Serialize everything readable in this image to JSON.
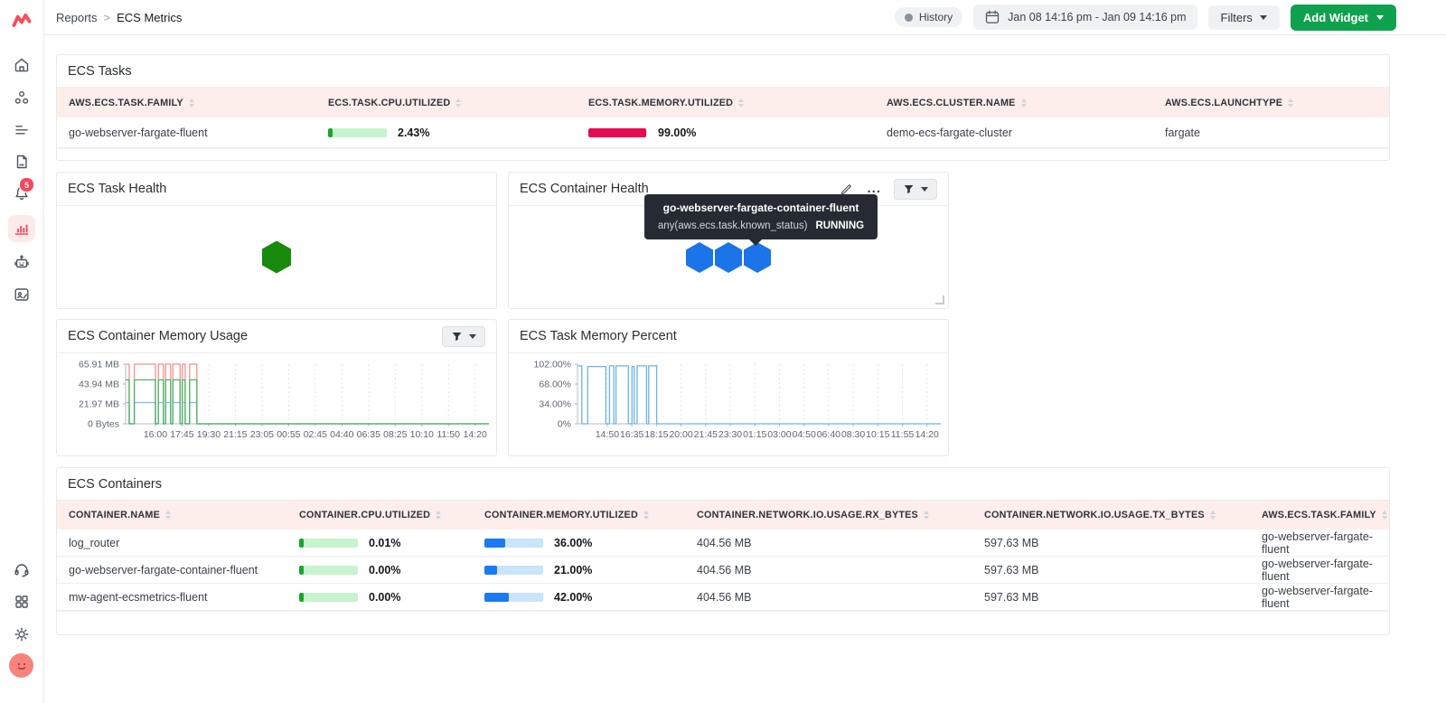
{
  "topbar": {
    "breadcrumb": {
      "section": "Reports",
      "separator": ">",
      "page": "ECS Metrics"
    },
    "history_label": "History",
    "date_range": "Jan 08 14:16 pm - Jan 09 14:16 pm",
    "filters_label": "Filters",
    "add_widget_label": "Add Widget"
  },
  "sidebar": {
    "notification_count": "5"
  },
  "colors": {
    "brand_red": "#fa4b57",
    "add_widget_green": "#0fa24e",
    "task_health_hex": "#178a0c",
    "container_health_hex": "#1b74e8",
    "table_header_pink": "#fdeeec",
    "cpu_bar_green": "#1ca52b",
    "memory_bar_red": "#e60a4e",
    "memory_bar_blue": "#1b79f1"
  },
  "ecs_tasks": {
    "title": "ECS Tasks",
    "columns": [
      "AWS.ECS.TASK.FAMILY",
      "ECS.TASK.CPU.UTILIZED",
      "ECS.TASK.MEMORY.UTILIZED",
      "AWS.ECS.CLUSTER.NAME",
      "AWS.ECS.LAUNCHTYPE"
    ],
    "rows": [
      {
        "family": "go-webserver-fargate-fluent",
        "cpu_label": "2.43%",
        "cpu_pct": 2.43,
        "memory_label": "99.00%",
        "memory_pct": 99,
        "cluster": "demo-ecs-fargate-cluster",
        "launchtype": "fargate"
      }
    ]
  },
  "task_health": {
    "title": "ECS Task Health"
  },
  "container_health": {
    "title": "ECS Container Health",
    "more_label": "...",
    "tooltip": {
      "title": "go-webserver-fargate-container-fluent",
      "metric": "any(aws.ecs.task.known_status)",
      "value": "RUNNING"
    }
  },
  "chart_data": [
    {
      "type": "line",
      "title": "ECS Container Memory Usage",
      "xlabel": "",
      "ylabel": "",
      "ylim": [
        0,
        65.91
      ],
      "grid": "vertical-dashed",
      "legend": "none",
      "yticks": [
        {
          "value": 65.91,
          "label": "65.91 MB"
        },
        {
          "value": 43.94,
          "label": "43.94 MB"
        },
        {
          "value": 21.97,
          "label": "21.97 MB"
        },
        {
          "value": 0,
          "label": "0 Bytes"
        }
      ],
      "xticks": [
        "16:00",
        "17:45",
        "19:30",
        "21:15",
        "23:05",
        "00:55",
        "02:45",
        "04:40",
        "06:35",
        "08:25",
        "10:10",
        "11:50",
        "14:20"
      ],
      "series": [
        {
          "color": "#f58f8f",
          "unit": "MB",
          "points": [
            [
              0,
              65.91
            ],
            [
              0.01,
              65.91
            ],
            [
              0.01,
              0
            ],
            [
              0.024,
              0
            ],
            [
              0.024,
              65.91
            ],
            [
              0.082,
              65.91
            ],
            [
              0.082,
              0
            ],
            [
              0.09,
              0
            ],
            [
              0.09,
              65.91
            ],
            [
              0.104,
              65.91
            ],
            [
              0.104,
              0
            ],
            [
              0.11,
              0
            ],
            [
              0.11,
              65.91
            ],
            [
              0.124,
              65.91
            ],
            [
              0.124,
              0
            ],
            [
              0.13,
              0
            ],
            [
              0.13,
              65.91
            ],
            [
              0.15,
              65.91
            ],
            [
              0.15,
              0
            ],
            [
              0.156,
              0
            ],
            [
              0.156,
              65.91
            ],
            [
              0.164,
              65.91
            ],
            [
              0.164,
              0
            ],
            [
              0.176,
              0
            ],
            [
              0.176,
              65.91
            ],
            [
              0.196,
              65.91
            ],
            [
              0.196,
              0
            ],
            [
              1,
              0
            ]
          ]
        },
        {
          "color": "#7dbcf0",
          "unit": "MB",
          "points": [
            [
              0,
              23.5
            ],
            [
              0.01,
              23.5
            ],
            [
              0.01,
              0
            ],
            [
              0.024,
              0
            ],
            [
              0.024,
              23.5
            ],
            [
              0.082,
              23.5
            ],
            [
              0.082,
              0
            ],
            [
              0.09,
              0
            ],
            [
              0.09,
              23.5
            ],
            [
              0.104,
              23.5
            ],
            [
              0.104,
              0
            ],
            [
              0.11,
              0
            ],
            [
              0.11,
              23.5
            ],
            [
              0.124,
              23.5
            ],
            [
              0.124,
              0
            ],
            [
              0.13,
              0
            ],
            [
              0.13,
              23.5
            ],
            [
              0.15,
              23.5
            ],
            [
              0.15,
              0
            ],
            [
              0.156,
              0
            ],
            [
              0.156,
              23.5
            ],
            [
              0.164,
              23.5
            ],
            [
              0.164,
              0
            ],
            [
              0.176,
              0
            ],
            [
              0.176,
              23.5
            ],
            [
              0.196,
              23.5
            ],
            [
              0.196,
              0
            ],
            [
              1,
              0
            ]
          ]
        },
        {
          "color": "#4eb264",
          "unit": "MB",
          "points": [
            [
              0,
              48.5
            ],
            [
              0.01,
              48.5
            ],
            [
              0.01,
              0
            ],
            [
              0.024,
              0
            ],
            [
              0.024,
              48.5
            ],
            [
              0.082,
              48.5
            ],
            [
              0.082,
              0
            ],
            [
              0.09,
              0
            ],
            [
              0.09,
              48.5
            ],
            [
              0.104,
              48.5
            ],
            [
              0.104,
              0
            ],
            [
              0.11,
              0
            ],
            [
              0.11,
              48.5
            ],
            [
              0.124,
              48.5
            ],
            [
              0.124,
              0
            ],
            [
              0.13,
              0
            ],
            [
              0.13,
              48.5
            ],
            [
              0.15,
              48.5
            ],
            [
              0.15,
              0
            ],
            [
              0.156,
              0
            ],
            [
              0.156,
              48.5
            ],
            [
              0.164,
              48.5
            ],
            [
              0.164,
              0
            ],
            [
              0.176,
              0
            ],
            [
              0.176,
              48.5
            ],
            [
              0.196,
              48.5
            ],
            [
              0.196,
              0
            ],
            [
              1,
              0
            ]
          ]
        }
      ]
    },
    {
      "type": "line",
      "title": "ECS Task Memory Percent",
      "xlabel": "",
      "ylabel": "",
      "ylim": [
        0,
        102
      ],
      "grid": "vertical-dashed",
      "legend": "none",
      "yticks": [
        {
          "value": 102,
          "label": "102.00%"
        },
        {
          "value": 68,
          "label": "68.00%"
        },
        {
          "value": 34,
          "label": "34.00%"
        },
        {
          "value": 0,
          "label": "0%"
        }
      ],
      "xticks": [
        "14:50",
        "16:35",
        "18:15",
        "20:00",
        "21:45",
        "23:30",
        "01:15",
        "03:00",
        "04:50",
        "06:40",
        "08:30",
        "10:15",
        "11:55",
        "14:20"
      ],
      "series": [
        {
          "color": "#6cb2ea",
          "unit": "%",
          "points": [
            [
              0,
              99
            ],
            [
              0.012,
              99
            ],
            [
              0.012,
              0
            ],
            [
              0.028,
              0
            ],
            [
              0.028,
              98
            ],
            [
              0.078,
              98
            ],
            [
              0.078,
              0
            ],
            [
              0.088,
              0
            ],
            [
              0.088,
              99
            ],
            [
              0.1,
              99
            ],
            [
              0.1,
              0
            ],
            [
              0.106,
              0
            ],
            [
              0.106,
              99
            ],
            [
              0.14,
              99
            ],
            [
              0.14,
              0
            ],
            [
              0.15,
              0
            ],
            [
              0.15,
              98
            ],
            [
              0.156,
              98
            ],
            [
              0.156,
              0
            ],
            [
              0.164,
              0
            ],
            [
              0.164,
              99
            ],
            [
              0.19,
              99
            ],
            [
              0.19,
              0
            ],
            [
              0.196,
              0
            ],
            [
              0.196,
              99
            ],
            [
              0.218,
              99
            ],
            [
              0.218,
              0
            ],
            [
              1,
              0
            ]
          ]
        }
      ]
    }
  ],
  "ecs_containers": {
    "title": "ECS Containers",
    "columns": [
      "CONTAINER.NAME",
      "CONTAINER.CPU.UTILIZED",
      "CONTAINER.MEMORY.UTILIZED",
      "CONTAINER.NETWORK.IO.USAGE.RX_BYTES",
      "CONTAINER.NETWORK.IO.USAGE.TX_BYTES",
      "AWS.ECS.TASK.FAMILY"
    ],
    "rows": [
      {
        "name": "log_router",
        "cpu_label": "0.01%",
        "cpu_pct": 0.01,
        "memory_label": "36.00%",
        "memory_pct": 36,
        "rx": "404.56 MB",
        "tx": "597.63 MB",
        "family": "go-webserver-fargate-fluent"
      },
      {
        "name": "go-webserver-fargate-container-fluent",
        "cpu_label": "0.00%",
        "cpu_pct": 0,
        "memory_label": "21.00%",
        "memory_pct": 21,
        "rx": "404.56 MB",
        "tx": "597.63 MB",
        "family": "go-webserver-fargate-fluent"
      },
      {
        "name": "mw-agent-ecsmetrics-fluent",
        "cpu_label": "0.00%",
        "cpu_pct": 0,
        "memory_label": "42.00%",
        "memory_pct": 42,
        "rx": "404.56 MB",
        "tx": "597.63 MB",
        "family": "go-webserver-fargate-fluent"
      }
    ]
  }
}
